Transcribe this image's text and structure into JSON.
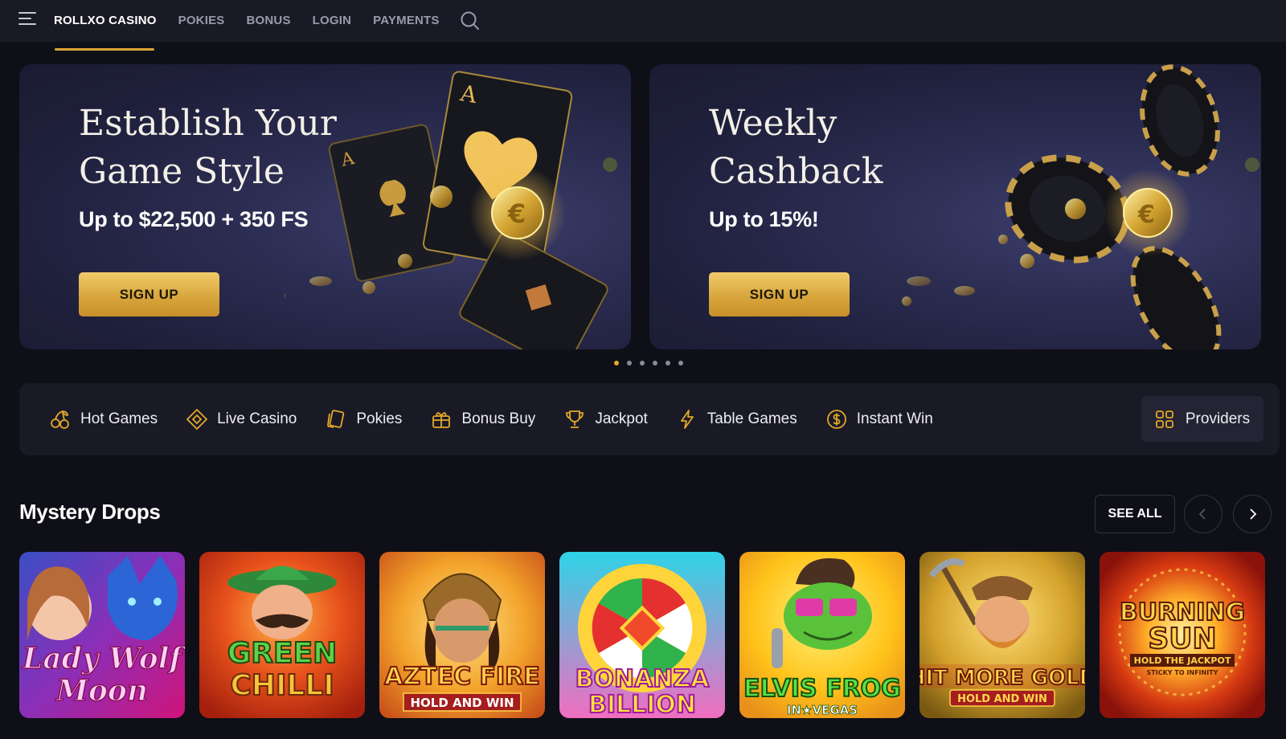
{
  "nav": {
    "brand": "ROLLXO CASINO",
    "links": [
      "POKIES",
      "BONUS",
      "LOGIN",
      "PAYMENTS"
    ]
  },
  "banners": [
    {
      "title": "Establish Your Game Style",
      "subtitle": "Up to $22,500 + 350 FS",
      "button": "SIGN UP"
    },
    {
      "title": "Weekly Cashback",
      "subtitle": "Up to 15%!",
      "button": "SIGN UP"
    }
  ],
  "carousel": {
    "total": 6,
    "active": 1
  },
  "categories": [
    {
      "label": "Hot Games",
      "icon": "cherries-icon"
    },
    {
      "label": "Live Casino",
      "icon": "diamond-chip-icon"
    },
    {
      "label": "Pokies",
      "icon": "cards-icon"
    },
    {
      "label": "Bonus Buy",
      "icon": "gift-box-icon"
    },
    {
      "label": "Jackpot",
      "icon": "trophy-icon"
    },
    {
      "label": "Table Games",
      "icon": "lightning-icon"
    },
    {
      "label": "Instant Win",
      "icon": "dollar-coin-icon"
    }
  ],
  "providers": {
    "label": "Providers",
    "icon": "grid-icon"
  },
  "section": {
    "title": "Mystery Drops",
    "see_all": "SEE ALL",
    "games": [
      {
        "name_lines": [
          "Lady Wolf",
          "Moon"
        ]
      },
      {
        "name_lines": [
          "GREEN",
          "CHILLI"
        ]
      },
      {
        "name_lines": [
          "AZTEC FIRE",
          "HOLD AND WIN"
        ]
      },
      {
        "name_lines": [
          "BONANZA",
          "BILLION"
        ]
      },
      {
        "name_lines": [
          "ELVIS FROG",
          "IN★VEGAS"
        ]
      },
      {
        "name_lines": [
          "HIT MORE GOLD",
          "HOLD AND WIN"
        ]
      },
      {
        "name_lines": [
          "BURNING",
          "SUN",
          "HOLD THE JACKPOT",
          "STICKY TO INFINITY"
        ]
      }
    ]
  },
  "colors": {
    "accent": "#d9a533",
    "background": "#0f0f17",
    "panel": "#1a1a26"
  }
}
